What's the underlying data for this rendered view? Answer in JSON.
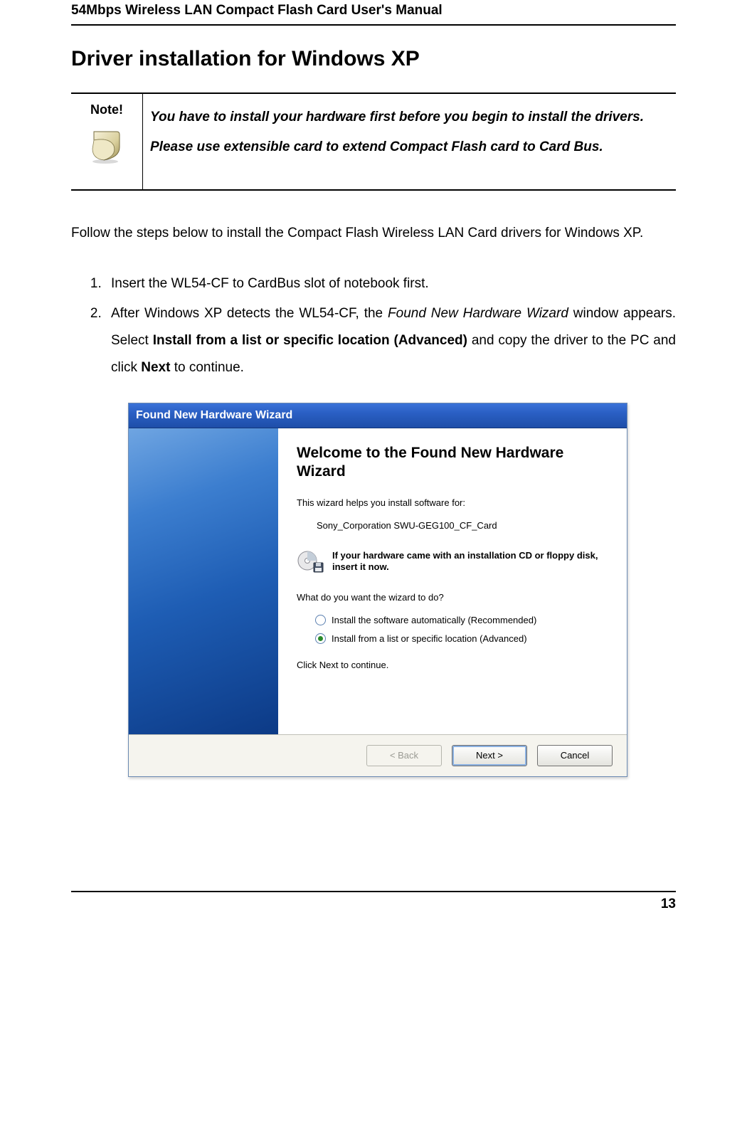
{
  "header": {
    "manual_title": "54Mbps Wireless LAN Compact Flash Card User's Manual"
  },
  "section": {
    "title": "Driver installation for Windows XP"
  },
  "note": {
    "label": "Note!",
    "line1": "You have to install your hardware first before you begin to install the drivers.",
    "line2": "Please use extensible card to extend Compact Flash card to Card Bus."
  },
  "intro": "Follow the steps below to install the Compact Flash Wireless LAN Card drivers for Windows XP.",
  "steps": {
    "s1": "Insert the WL54-CF to CardBus slot of notebook first.",
    "s2_a": "After Windows XP detects the WL54-CF, the ",
    "s2_italic": "Found New Hardware Wizard",
    "s2_b": " window appears. Select ",
    "s2_bold1": "Install from a list or specific location (Advanced)",
    "s2_c": " and copy the driver to the PC and click ",
    "s2_bold2": "Next",
    "s2_d": " to continue."
  },
  "wizard": {
    "titlebar": "Found New Hardware Wizard",
    "main_title": "Welcome to the Found New Hardware Wizard",
    "helps_text": "This wizard helps you install software for:",
    "device_name": "Sony_Corporation SWU-GEG100_CF_Card",
    "media_text": "If your hardware came with an installation CD or floppy disk, insert it now.",
    "question": "What do you want the wizard to do?",
    "radio1": "Install the software automatically (Recommended)",
    "radio2": "Install from a list or specific location (Advanced)",
    "click_next": "Click Next to continue.",
    "buttons": {
      "back": "< Back",
      "next": "Next >",
      "cancel": "Cancel"
    }
  },
  "page_number": "13"
}
